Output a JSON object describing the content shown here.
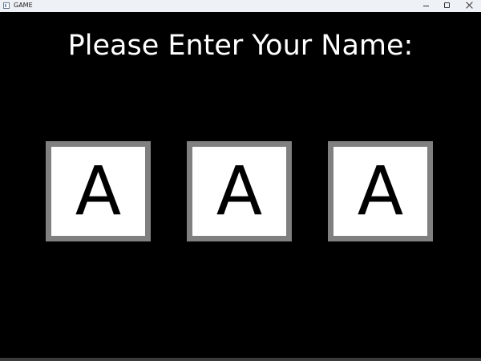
{
  "window": {
    "title": "GAME",
    "app_icon": "app-window-icon",
    "controls": [
      "minimize-icon",
      "maximize-icon",
      "close-icon"
    ]
  },
  "game": {
    "prompt": "Please Enter Your Name:",
    "letters": [
      "A",
      "A",
      "A"
    ]
  },
  "colors": {
    "background": "#000000",
    "prompt_text": "#ffffff",
    "slot_fill": "#ffffff",
    "slot_border": "#808080",
    "letter_text": "#000000",
    "titlebar": "#eef2f7"
  }
}
